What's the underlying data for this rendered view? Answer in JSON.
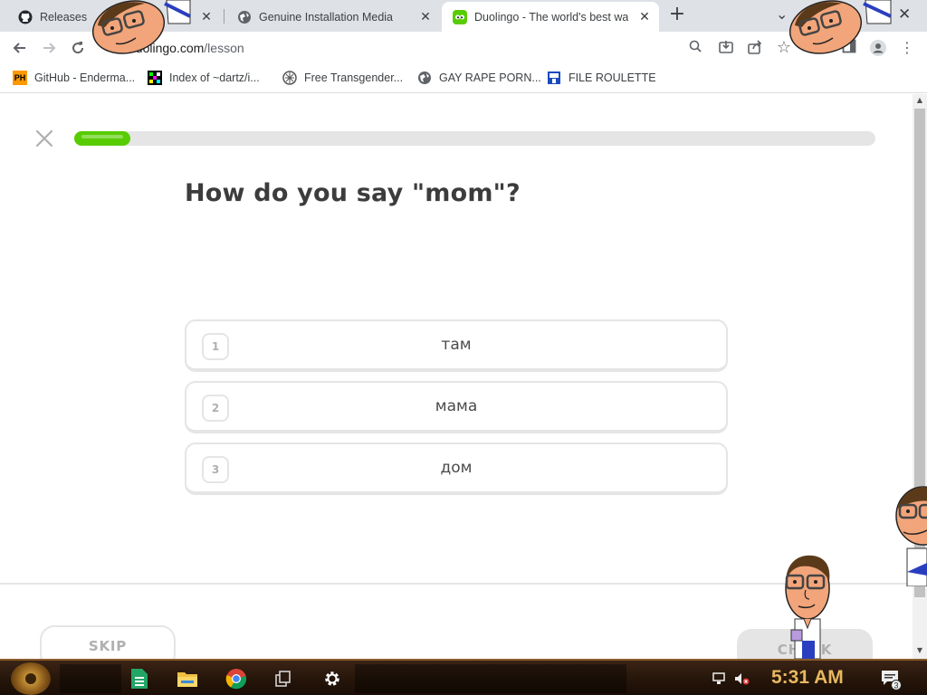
{
  "browser": {
    "tabs": [
      {
        "title": "Releases",
        "active": false
      },
      {
        "title": "Genuine Installation Media",
        "active": false
      },
      {
        "title": "Duolingo - The world's best wa",
        "active": true
      }
    ],
    "url_domain": "duolingo.com",
    "url_path": "/lesson",
    "bookmarks": [
      {
        "label": "GitHub - Enderma...",
        "icon": "ph-logo-icon"
      },
      {
        "label": "Index of ~dartz/i...",
        "icon": "pixel-icon"
      },
      {
        "label": "Free Transgender...",
        "icon": "globe-pattern-icon"
      },
      {
        "label": "GAY RAPE PORN...",
        "icon": "globe-icon"
      },
      {
        "label": "FILE ROULETTE",
        "icon": "file-icon"
      }
    ]
  },
  "lesson": {
    "progress": 0.07,
    "prompt": "How do you say \"mom\"?",
    "choices": [
      {
        "key": "1",
        "text": "там"
      },
      {
        "key": "2",
        "text": "мама"
      },
      {
        "key": "3",
        "text": "дом"
      }
    ],
    "skip_label": "SKIP",
    "check_label": "CHECK"
  },
  "taskbar": {
    "clock": "5:31 AM",
    "notification_count": "3"
  },
  "colors": {
    "progress_green": "#58cc02",
    "border_gray": "#e5e5e5",
    "taskbar_brown": "#241409"
  }
}
